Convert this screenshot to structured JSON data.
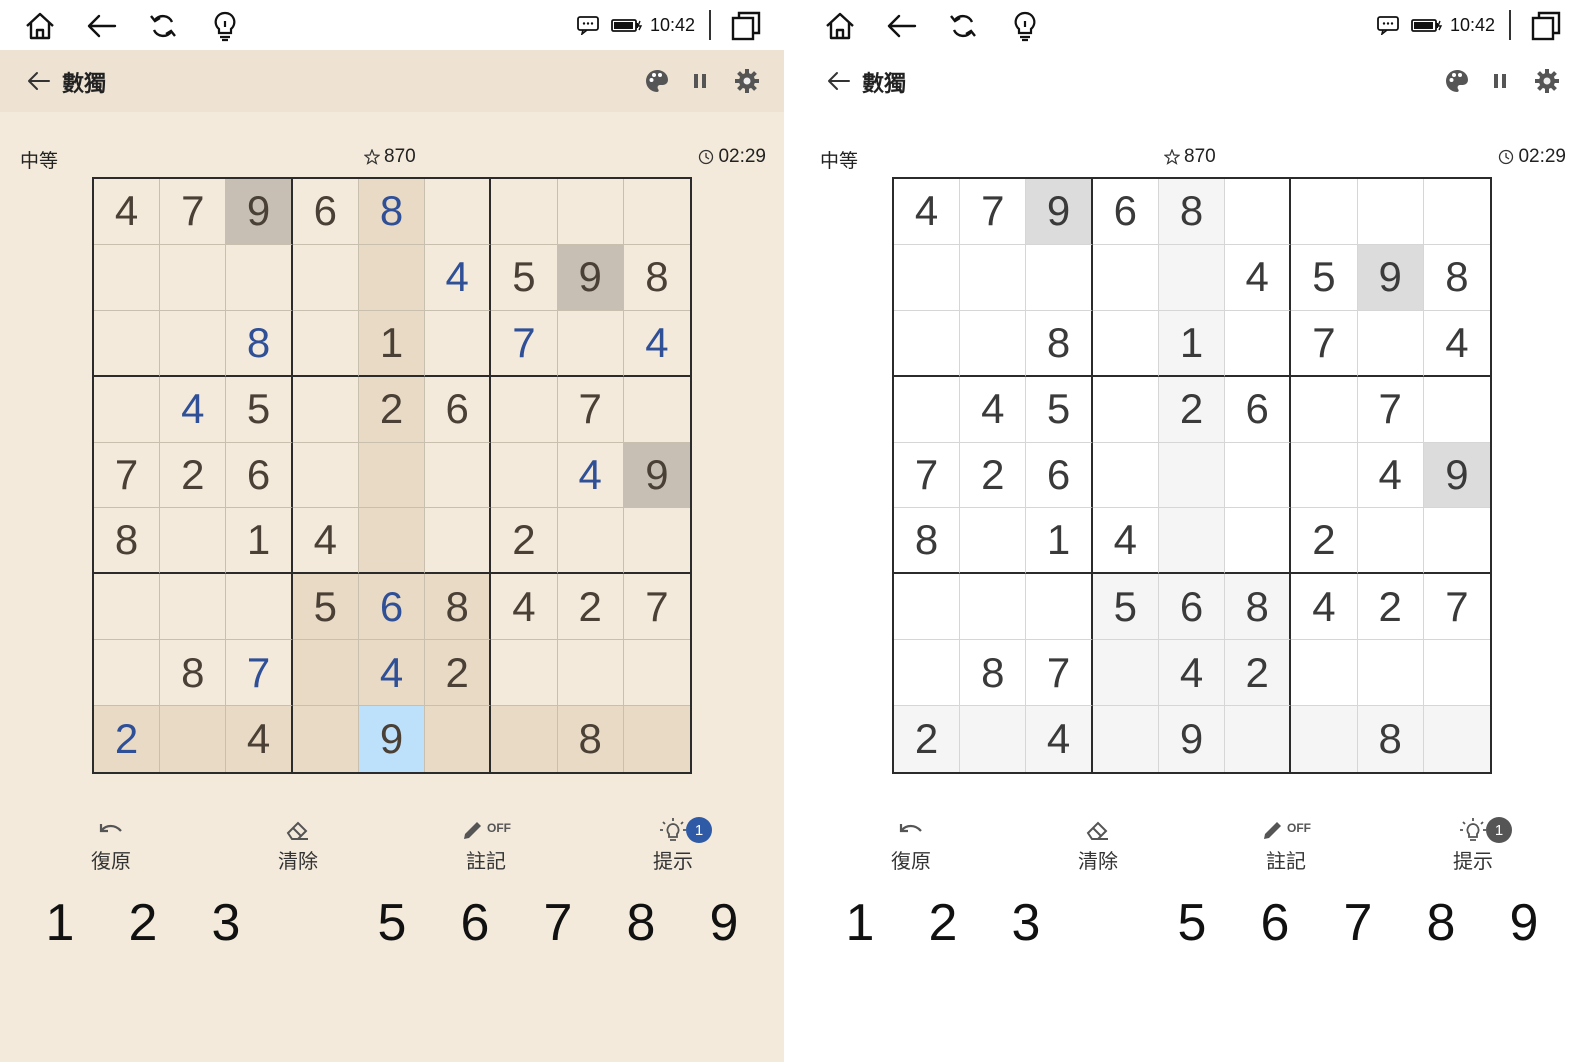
{
  "system": {
    "time": "10:42"
  },
  "app": {
    "title": "數獨"
  },
  "info": {
    "difficulty": "中等",
    "score": "870",
    "timer": "02:29"
  },
  "tools": [
    {
      "label": "復原",
      "icon": "undo-icon"
    },
    {
      "label": "清除",
      "icon": "eraser-icon"
    },
    {
      "label": "註記",
      "icon": "pencil-icon",
      "tag": "OFF"
    },
    {
      "label": "提示",
      "icon": "lightbulb-icon",
      "badge": "1"
    }
  ],
  "numpad": [
    "1",
    "2",
    "3",
    "",
    "5",
    "6",
    "7",
    "8",
    "9"
  ],
  "board": {
    "rows": [
      [
        "4",
        "7",
        "9",
        "6",
        "8",
        "",
        "",
        "",
        ""
      ],
      [
        "",
        "",
        "",
        "",
        "",
        "4",
        "5",
        "9",
        "8"
      ],
      [
        "",
        "",
        "8",
        "",
        "1",
        "",
        "7",
        "",
        "4"
      ],
      [
        "",
        "4",
        "5",
        "",
        "2",
        "6",
        "",
        "7",
        ""
      ],
      [
        "7",
        "2",
        "6",
        "",
        "",
        "",
        "",
        "4",
        "9"
      ],
      [
        "8",
        "",
        "1",
        "4",
        "",
        "",
        "2",
        "",
        ""
      ],
      [
        "",
        "",
        "",
        "5",
        "6",
        "8",
        "4",
        "2",
        "7"
      ],
      [
        "",
        "8",
        "7",
        "",
        "4",
        "2",
        "",
        "",
        ""
      ],
      [
        "2",
        "",
        "4",
        "",
        "9",
        "",
        "",
        "8",
        ""
      ]
    ],
    "user_entered": [
      [
        0,
        4
      ],
      [
        1,
        5
      ],
      [
        2,
        2
      ],
      [
        2,
        6
      ],
      [
        2,
        8
      ],
      [
        3,
        1
      ],
      [
        4,
        7
      ],
      [
        6,
        4
      ],
      [
        7,
        2
      ],
      [
        7,
        4
      ],
      [
        8,
        0
      ]
    ],
    "same_number_cells": [
      [
        0,
        2
      ],
      [
        1,
        7
      ],
      [
        4,
        8
      ]
    ],
    "selected_cell": [
      8,
      4
    ]
  }
}
